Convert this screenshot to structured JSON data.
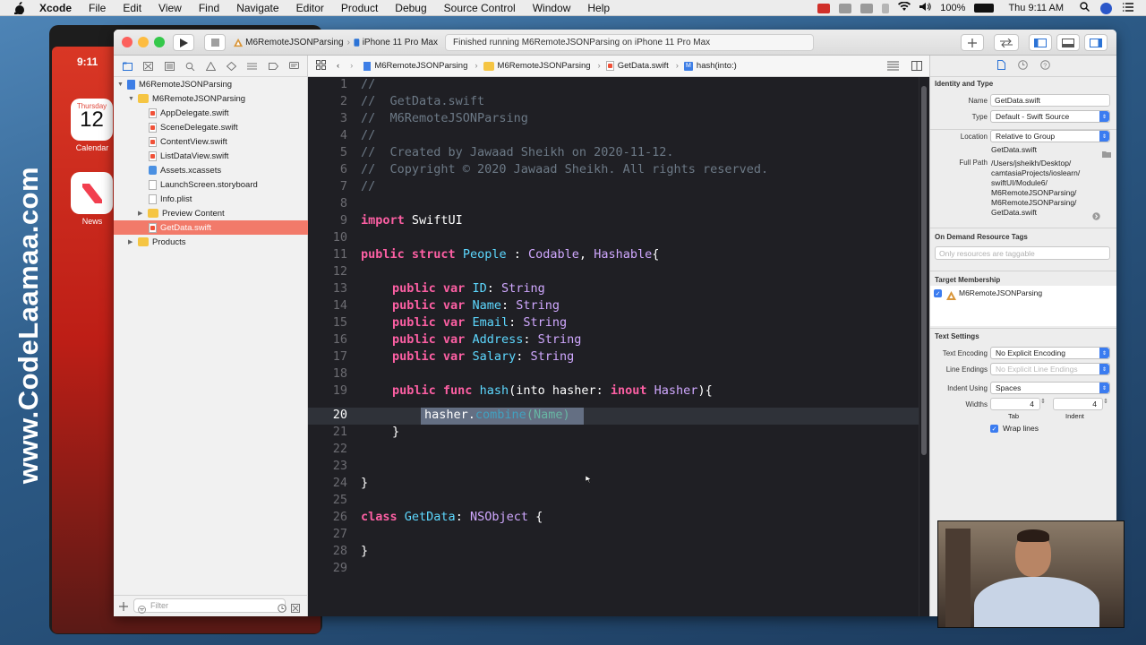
{
  "menubar": {
    "app": "Xcode",
    "items": [
      "File",
      "Edit",
      "View",
      "Find",
      "Navigate",
      "Editor",
      "Product",
      "Debug",
      "Source Control",
      "Window",
      "Help"
    ],
    "battery": "100%",
    "clock": "Thu 9:11 AM"
  },
  "simulator": {
    "time": "9:11",
    "calendar_day_name": "Thursday",
    "calendar_day": "12",
    "calendar_label": "Calendar",
    "news_label": "News"
  },
  "watermark": "www.CodeLaamaa.com",
  "toolbar": {
    "scheme": "M6RemoteJSONParsing",
    "device": "iPhone 11 Pro Max",
    "activity": "Finished running M6RemoteJSONParsing on iPhone 11 Pro Max"
  },
  "navigator": {
    "items": [
      {
        "label": "M6RemoteJSONParsing"
      },
      {
        "label": "M6RemoteJSONParsing"
      },
      {
        "label": "AppDelegate.swift"
      },
      {
        "label": "SceneDelegate.swift"
      },
      {
        "label": "ContentView.swift"
      },
      {
        "label": "ListDataView.swift"
      },
      {
        "label": "Assets.xcassets"
      },
      {
        "label": "LaunchScreen.storyboard"
      },
      {
        "label": "Info.plist"
      },
      {
        "label": "Preview Content"
      },
      {
        "label": "GetData.swift"
      },
      {
        "label": "Products"
      }
    ],
    "filter_placeholder": "Filter"
  },
  "jumpbar": {
    "crumbs": [
      "M6RemoteJSONParsing",
      "M6RemoteJSONParsing",
      "GetData.swift",
      "hash(into:)"
    ]
  },
  "editor": {
    "current_line": "20",
    "line_numbers": [
      "1",
      "2",
      "3",
      "4",
      "5",
      "6",
      "7",
      "8",
      "9",
      "10",
      "11",
      "12",
      "13",
      "14",
      "15",
      "16",
      "17",
      "18",
      "19",
      "20",
      "21",
      "22",
      "23",
      "24",
      "25",
      "26",
      "27",
      "28",
      "29"
    ],
    "code": {
      "l1": "//",
      "l2": "//  GetData.swift",
      "l3": "//  M6RemoteJSONParsing",
      "l4": "//",
      "l5": "//  Created by Jawaad Sheikh on 2020-11-12.",
      "l6": "//  Copyright © 2020 Jawaad Sheikh. All rights reserved.",
      "l7": "//",
      "kw_import": "import",
      "mod_swiftui": " SwiftUI",
      "kw_public": "public",
      "kw_struct": "struct",
      "name_people": "People",
      "colon": " : ",
      "codable": "Codable",
      "comma": ", ",
      "hashable": "Hashable",
      "brace_open": "{",
      "kw_var": "var",
      "id": "ID",
      "name": "Name",
      "email": "Email",
      "address": "Address",
      "salary": "Salary",
      "type_sep": ": ",
      "string": "String",
      "kw_func": "func",
      "fn_hash": "hash",
      "params_a": "(into hasher: ",
      "kw_inout": "inout",
      "hasher_type": "Hasher",
      "params_b": "){",
      "hasher_var": "hasher.",
      "combine": "combine",
      "paren_open": "(",
      "name_arg": "Name",
      "paren_close": ")",
      "brace_close": "}",
      "kw_class": "class",
      "getdata": "GetData",
      "nsobject": "NSObject",
      "class_open": " {"
    }
  },
  "inspector": {
    "identity_title": "Identity and Type",
    "name_label": "Name",
    "name_value": "GetData.swift",
    "type_label": "Type",
    "type_value": "Default - Swift Source",
    "location_label": "Location",
    "location_value": "Relative to Group",
    "location_file": "GetData.swift",
    "fullpath_label": "Full Path",
    "fullpath_lines": [
      "/Users/jsheikh/Desktop/",
      "camtasiaProjects/ioslearn/",
      "swiftUI/Module6/",
      "M6RemoteJSONParsing/",
      "M6RemoteJSONParsing/",
      "GetData.swift"
    ],
    "odr_title": "On Demand Resource Tags",
    "odr_placeholder": "Only resources are taggable",
    "target_title": "Target Membership",
    "target_value": "M6RemoteJSONParsing",
    "text_title": "Text Settings",
    "encoding_label": "Text Encoding",
    "encoding_value": "No Explicit Encoding",
    "line_endings_label": "Line Endings",
    "line_endings_value": "No Explicit Line Endings",
    "indent_label": "Indent Using",
    "indent_value": "Spaces",
    "widths_label": "Widths",
    "tab_value": "4",
    "indent_width_value": "4",
    "tab_label": "Tab",
    "indent_sub_label": "Indent",
    "wrap_label": "Wrap lines"
  }
}
